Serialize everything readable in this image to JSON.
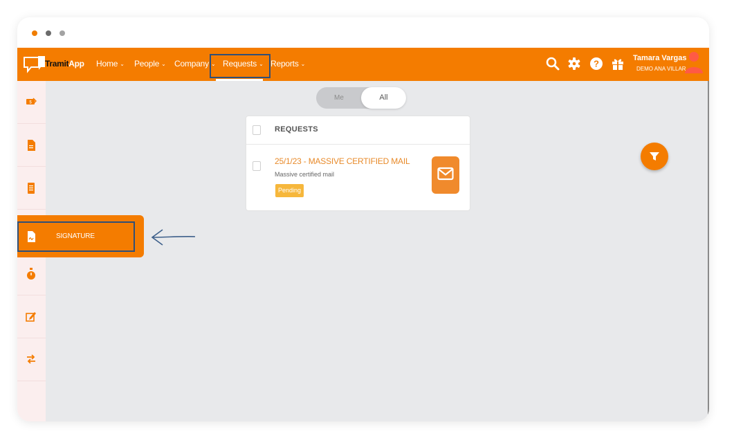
{
  "brand": {
    "name_part1": "Tramit",
    "name_part2": "App"
  },
  "nav": {
    "items": [
      {
        "label": "Home",
        "id": "home"
      },
      {
        "label": "People",
        "id": "people"
      },
      {
        "label": "Company",
        "id": "company"
      },
      {
        "label": "Requests",
        "id": "requests",
        "active": true
      },
      {
        "label": "Reports",
        "id": "reports"
      }
    ],
    "icons": [
      "search-icon",
      "settings-icon",
      "help-icon",
      "gift-icon"
    ]
  },
  "user": {
    "name": "Tamara Vargas",
    "company": "DEMO ANA VILLAR"
  },
  "sidebar": {
    "items": [
      {
        "icon": "expense-icon"
      },
      {
        "icon": "document-icon"
      },
      {
        "icon": "list-document-icon"
      },
      {
        "icon": "signature-document-icon",
        "label": "SIGNATURE",
        "expanded": true
      },
      {
        "icon": "stopwatch-icon"
      },
      {
        "icon": "edit-icon"
      },
      {
        "icon": "transfer-icon"
      }
    ]
  },
  "toggle": {
    "me_label": "Me",
    "all_label": "All",
    "selected": "All"
  },
  "requests_card": {
    "header": "REQUESTS",
    "items": [
      {
        "title": "25/1/23 - MASSIVE CERTIFIED MAIL",
        "subtitle": "Massive certified mail",
        "status": "Pending",
        "icon": "envelope-icon"
      }
    ]
  },
  "colors": {
    "primary": "#f47c00",
    "highlight_border": "#2f4f78",
    "pending_badge": "#f6b73c",
    "content_bg": "#e8e9eb",
    "sidebar_bg": "#fbeeee"
  }
}
